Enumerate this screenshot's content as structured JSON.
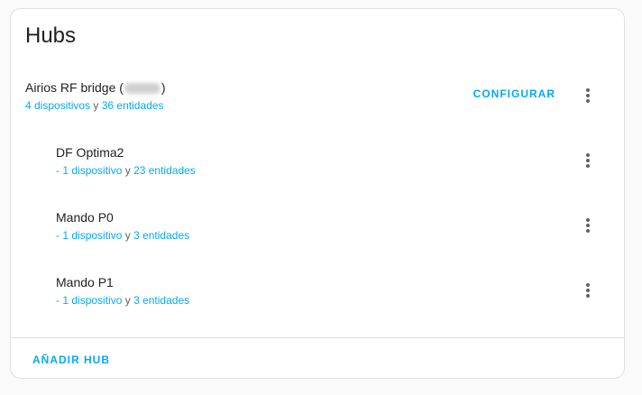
{
  "card": {
    "title": "Hubs"
  },
  "hub": {
    "name_prefix": "Airios RF bridge (",
    "name_suffix": ")",
    "devices_label": "4 dispositivos",
    "connector": " y ",
    "entities_label": "36 entidades",
    "configure_label": "CONFIGURAR"
  },
  "subdevices": [
    {
      "name": "DF Optima2",
      "dash": "- ",
      "devices_label": "1 dispositivo",
      "connector": " y ",
      "entities_label": "23 entidades"
    },
    {
      "name": "Mando P0",
      "dash": "- ",
      "devices_label": "1 dispositivo",
      "connector": " y ",
      "entities_label": "3 entidades"
    },
    {
      "name": "Mando P1",
      "dash": "- ",
      "devices_label": "1 dispositivo",
      "connector": " y ",
      "entities_label": "3 entidades"
    }
  ],
  "footer": {
    "add_hub_label": "AÑADIR HUB"
  },
  "icons": {
    "overflow_menu": "dots-vertical-icon"
  },
  "colors": {
    "accent": "#03a9f4",
    "text_primary": "#212121",
    "text_secondary": "#616161"
  }
}
